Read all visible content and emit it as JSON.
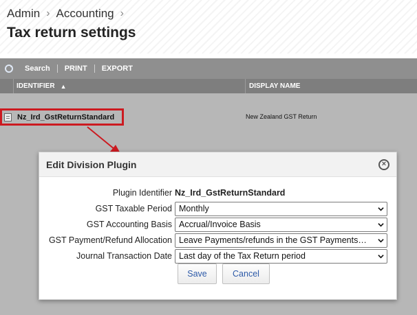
{
  "breadcrumb": {
    "items": [
      "Admin",
      "Accounting"
    ]
  },
  "page": {
    "title": "Tax return settings"
  },
  "toolbar": {
    "search": "Search",
    "print": "PRINT",
    "export": "EXPORT"
  },
  "grid": {
    "columns": [
      "IDENTIFIER",
      "DISPLAY NAME"
    ],
    "sort_indicator": "▲",
    "rows": [
      {
        "identifier": "Nz_Ird_GstReturnStandard",
        "display_name": "New Zealand GST Return"
      }
    ]
  },
  "annotation": {
    "highlight_color": "#cc1a20"
  },
  "dialog": {
    "title": "Edit Division Plugin",
    "close_icon": "close-circle-icon",
    "fields": [
      {
        "label": "Plugin Identifier",
        "value": "Nz_Ird_GstReturnStandard"
      },
      {
        "label": "GST Taxable Period",
        "value": "Monthly"
      },
      {
        "label": "GST Accounting Basis",
        "value": "Accrual/Invoice Basis"
      },
      {
        "label": "GST Payment/Refund Allocation",
        "value": "Leave Payments/refunds in the GST Payments…"
      },
      {
        "label": "Journal Transaction Date",
        "value": "Last day of the Tax Return period"
      }
    ],
    "save_label": "Save",
    "cancel_label": "Cancel"
  }
}
